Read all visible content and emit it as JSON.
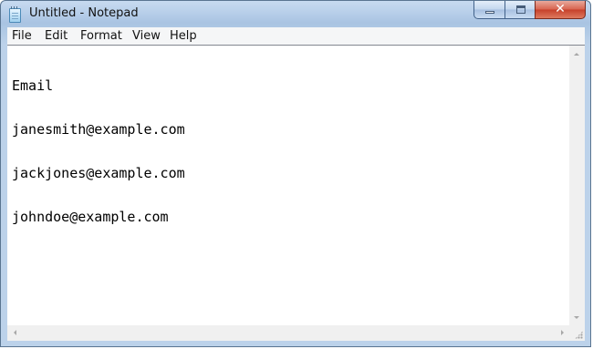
{
  "window": {
    "title": "Untitled - Notepad",
    "close_glyph": "✕"
  },
  "menu": {
    "items": [
      "File",
      "Edit",
      "Format",
      "View",
      "Help"
    ]
  },
  "editor": {
    "lines": [
      "Email",
      "janesmith@example.com",
      "jackjones@example.com",
      "johndoe@example.com"
    ]
  },
  "icons": {
    "app": "notepad-icon",
    "minimize": "minimize-icon",
    "maximize": "maximize-icon",
    "close": "close-icon"
  },
  "colors": {
    "title_bar": "#b9d0ea",
    "close_button": "#c6402a",
    "menu_bar": "#f5f6f7",
    "editor_background": "#ffffff",
    "text": "#000000"
  }
}
